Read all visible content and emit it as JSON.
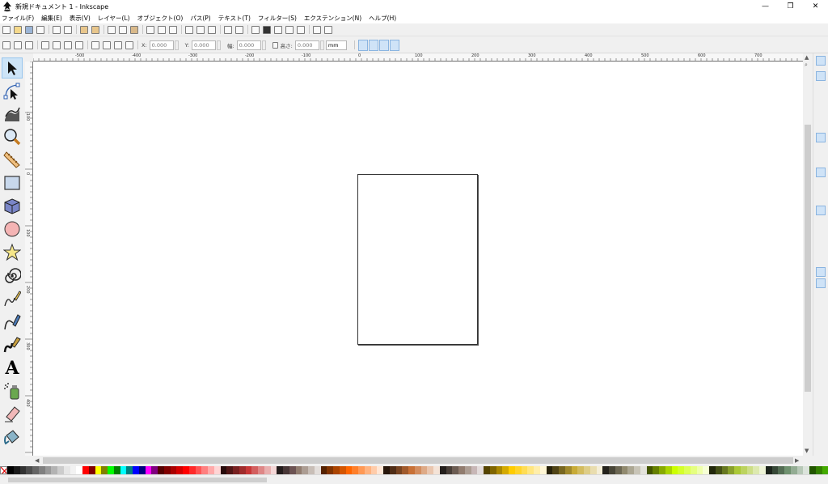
{
  "window": {
    "title": "新規ドキュメント 1 - Inkscape",
    "minimize": "—",
    "maximize": "❐",
    "close": "✕"
  },
  "menu": [
    "ファイル(F)",
    "編集(E)",
    "表示(V)",
    "レイヤー(L)",
    "オブジェクト(O)",
    "パス(P)",
    "テキスト(T)",
    "フィルター(S)",
    "エクステンション(N)",
    "ヘルプ(H)"
  ],
  "controls": {
    "x_label": "X:",
    "x_value": "0.000",
    "y_label": "Y:",
    "y_value": "0.000",
    "w_label": "幅:",
    "w_value": "0.000",
    "h_label": "高さ:",
    "h_value": "0.000",
    "unit": "mm"
  },
  "ruler": {
    "h_labels": [
      "-500",
      "-400",
      "-300",
      "-200",
      "-100",
      "0",
      "100",
      "200",
      "300",
      "400",
      "500",
      "600",
      "700"
    ],
    "v_labels": [
      "-100",
      "0",
      "100",
      "200",
      "300",
      "400"
    ]
  },
  "tools": [
    {
      "name": "selector-tool-icon",
      "active": true
    },
    {
      "name": "node-tool-icon",
      "active": false
    },
    {
      "name": "tweak-tool-icon",
      "active": false
    },
    {
      "name": "zoom-tool-icon",
      "active": false
    },
    {
      "name": "measure-tool-icon",
      "active": false
    },
    {
      "name": "rectangle-tool-icon",
      "active": false
    },
    {
      "name": "3d-box-tool-icon",
      "active": false
    },
    {
      "name": "ellipse-tool-icon",
      "active": false
    },
    {
      "name": "star-tool-icon",
      "active": false
    },
    {
      "name": "spiral-tool-icon",
      "active": false
    },
    {
      "name": "pencil-tool-icon",
      "active": false
    },
    {
      "name": "pen-tool-icon",
      "active": false
    },
    {
      "name": "calligraphy-tool-icon",
      "active": false
    },
    {
      "name": "text-tool-icon",
      "active": false
    },
    {
      "name": "spray-tool-icon",
      "active": false
    },
    {
      "name": "eraser-tool-icon",
      "active": false
    },
    {
      "name": "paint-bucket-tool-icon",
      "active": false
    }
  ],
  "text_tool_glyph": "A",
  "palette": [
    "#000000",
    "#1a1a1a",
    "#333333",
    "#4d4d4d",
    "#666666",
    "#808080",
    "#999999",
    "#b3b3b3",
    "#cccccc",
    "#e6e6e6",
    "#f2f2f2",
    "#ffffff",
    "#ff0000",
    "#800000",
    "#ffff00",
    "#808000",
    "#00ff00",
    "#008000",
    "#00ffff",
    "#008080",
    "#0000ff",
    "#000080",
    "#ff00ff",
    "#800080",
    "#550000",
    "#800000",
    "#aa0000",
    "#d40000",
    "#ff0000",
    "#ff2a2a",
    "#ff5555",
    "#ff8080",
    "#ffaaaa",
    "#ffd5d5",
    "#280b0b",
    "#501616",
    "#782121",
    "#a02c2c",
    "#c83737",
    "#d35f5f",
    "#de8787",
    "#e9afaf",
    "#f4d7d7",
    "#241c1c",
    "#483737",
    "#6c5353",
    "#917c6f",
    "#ac9d93",
    "#c8beb7",
    "#e3dedb",
    "#552200",
    "#803300",
    "#aa4400",
    "#d45500",
    "#ff6600",
    "#ff7f2a",
    "#ff9955",
    "#ffb380",
    "#ffccaa",
    "#ffe6d5",
    "#28170b",
    "#502d16",
    "#784421",
    "#a05a2c",
    "#c87137",
    "#d38d5f",
    "#deaa87",
    "#e9c6af",
    "#f4e3d7",
    "#241f1c",
    "#483e37",
    "#6c5d53",
    "#917c6f",
    "#ac9d93",
    "#c8b7b7",
    "#e3dbdb",
    "#554400",
    "#806600",
    "#aa8800",
    "#d4aa00",
    "#ffcc00",
    "#ffd42a",
    "#ffdd55",
    "#ffe680",
    "#ffeeaa",
    "#fff6d5",
    "#28220b",
    "#504416",
    "#786721",
    "#a0892c",
    "#c8ab37",
    "#d3bc5f",
    "#decd87",
    "#e9ddaf",
    "#f4eed7",
    "#24221c",
    "#484537",
    "#6c6753",
    "#918a6f",
    "#aca793",
    "#c8c4b7",
    "#e3e2db",
    "#445500",
    "#668000",
    "#88aa00",
    "#aad400",
    "#ccff00",
    "#d4ff2a",
    "#ddff55",
    "#e5ff80",
    "#eeffaa",
    "#f6ffd5",
    "#22280b",
    "#445016",
    "#677821",
    "#89a02c",
    "#abc837",
    "#bcd35f",
    "#cdde87",
    "#dde9af",
    "#eef4d7",
    "#1c241c",
    "#374837",
    "#536c53",
    "#6f916f",
    "#93ac93",
    "#b7c8b7",
    "#dbe3db",
    "#225500",
    "#338000",
    "#44aa00"
  ]
}
